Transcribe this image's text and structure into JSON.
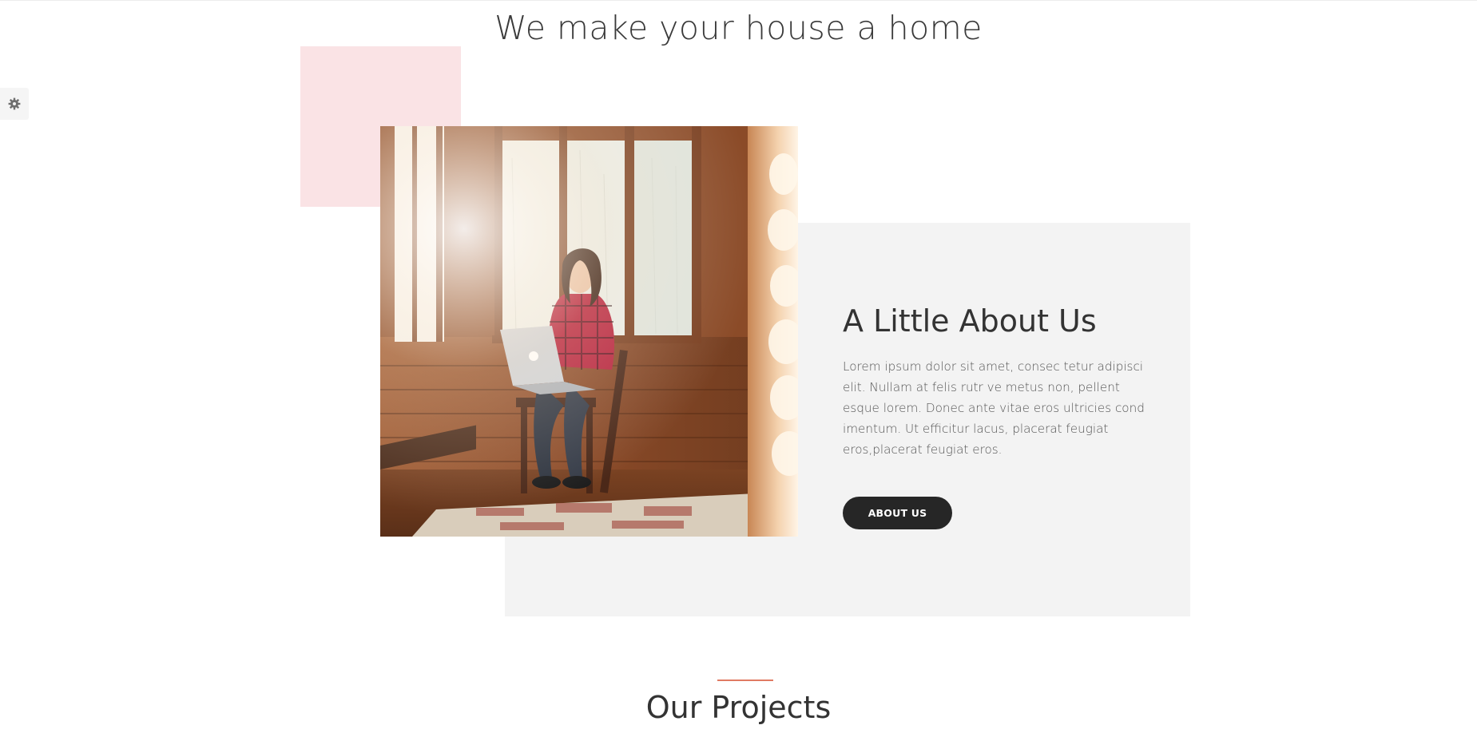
{
  "hero": {
    "tagline": "We make your house a home"
  },
  "settings": {
    "icon": "gear-icon"
  },
  "about": {
    "title": "A Little About Us",
    "text": "Lorem ipsum dolor sit amet, consec tetur adipisci elit. Nullam at felis rutr ve metus non, pellent esque lorem. Donec ante vitae eros ultricies cond imentum. Ut efficitur lacus, placerat feugiat eros,placerat feugiat eros.",
    "button_label": "ABOUT US",
    "photo_icon": "woman-with-laptop-photo"
  },
  "projects": {
    "title": "Our Projects"
  },
  "colors": {
    "pink_block": "#fae3e5",
    "panel_grey": "#f3f3f3",
    "button_dark": "#262626",
    "accent_rule": "#e07a63",
    "text_dark": "#333333"
  }
}
